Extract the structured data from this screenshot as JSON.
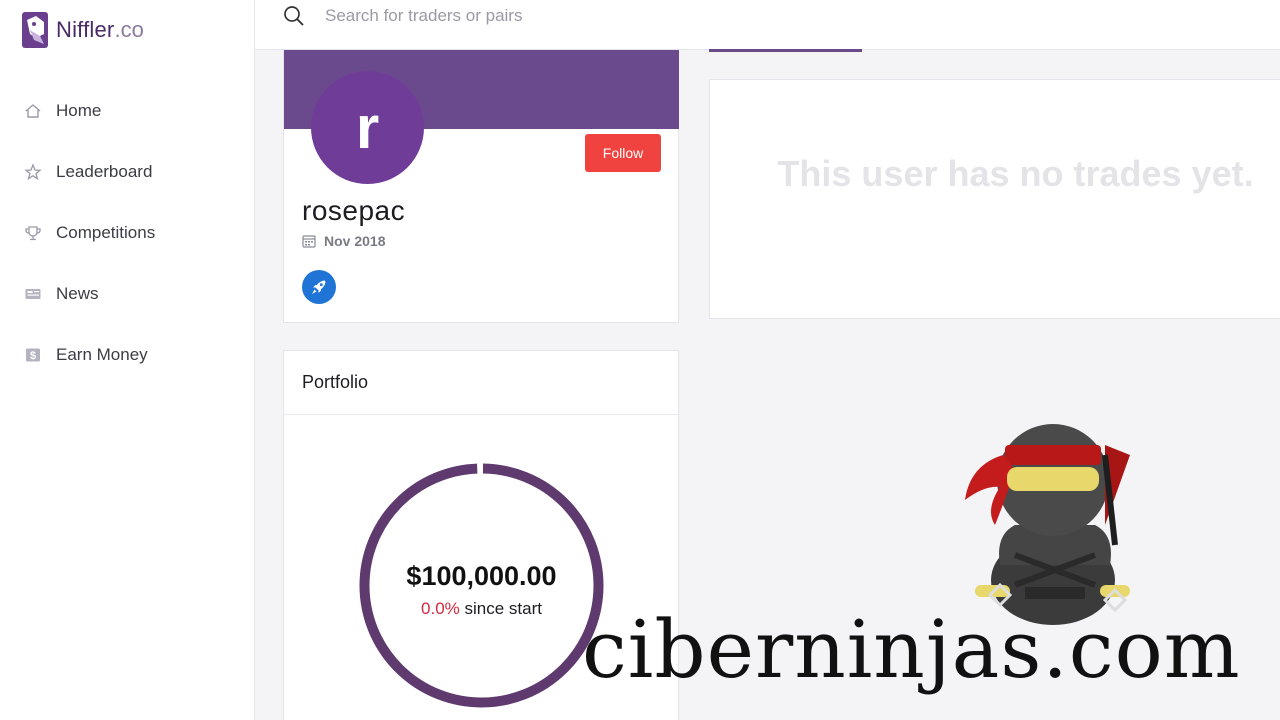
{
  "brand": {
    "name": "Niffler",
    "tld": ".co"
  },
  "sidebar": {
    "items": [
      {
        "label": "Home",
        "icon": "home-icon"
      },
      {
        "label": "Leaderboard",
        "icon": "star-icon"
      },
      {
        "label": "Competitions",
        "icon": "trophy-icon"
      },
      {
        "label": "News",
        "icon": "newspaper-icon"
      },
      {
        "label": "Earn Money",
        "icon": "dollar-icon"
      }
    ]
  },
  "search": {
    "placeholder": "Search for traders or pairs",
    "value": ""
  },
  "profile": {
    "avatar_letter": "r",
    "username": "rosepac",
    "joined": "Nov 2018",
    "follow_label": "Follow",
    "badge_icon": "rocket-icon"
  },
  "trades": {
    "empty_message": "This user has no trades yet."
  },
  "portfolio": {
    "title": "Portfolio",
    "value": "$100,000.00",
    "change_pct": "0.0%",
    "change_suffix": "since start"
  },
  "watermark": {
    "text": "ciberninjas.com"
  },
  "colors": {
    "brand_purple": "#6a4a8c",
    "avatar_purple": "#6f3d98",
    "follow_red": "#f0423f",
    "badge_blue": "#1f74d6",
    "negative_red": "#d6283f",
    "donut_ring": "#5e3a6e"
  }
}
